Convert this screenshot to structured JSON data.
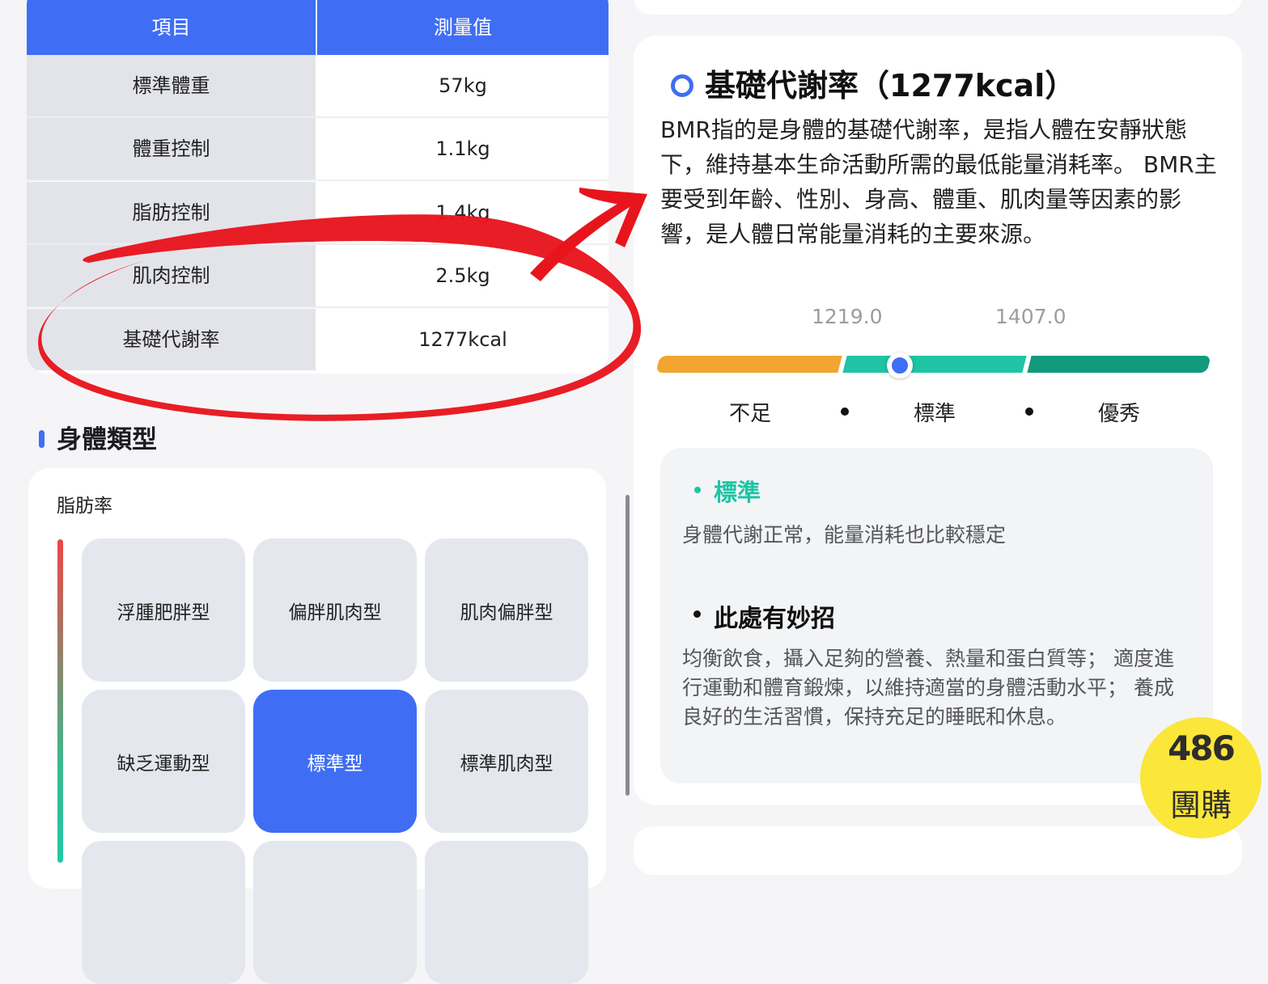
{
  "table": {
    "header": {
      "item": "項目",
      "value": "測量值"
    },
    "rows": [
      {
        "label": "標準體重",
        "value": "57kg"
      },
      {
        "label": "體重控制",
        "value": "1.1kg"
      },
      {
        "label": "脂肪控制",
        "value": "1.4kg"
      },
      {
        "label": "肌肉控制",
        "value": "2.5kg"
      },
      {
        "label": "基礎代謝率",
        "value": "1277kcal"
      }
    ]
  },
  "body_type": {
    "title": "身體類型",
    "axis_label": "脂肪率",
    "tiles": [
      {
        "label": "浮腫肥胖型",
        "active": false
      },
      {
        "label": "偏胖肌肉型",
        "active": false
      },
      {
        "label": "肌肉偏胖型",
        "active": false
      },
      {
        "label": "缺乏運動型",
        "active": false
      },
      {
        "label": "標準型",
        "active": true
      },
      {
        "label": "標準肌肉型",
        "active": false
      }
    ]
  },
  "bmr": {
    "title": "基礎代謝率（1277kcal）",
    "description": "BMR指的是身體的基礎代謝率，是指人體在安靜狀態下，維持基本生命活動所需的最低能量消耗率。 BMR主要受到年齡、性別、身高、體重、肌肉量等因素的影響，是人體日常能量消耗的主要來源。",
    "thresholds": [
      "1219.0",
      "1407.0"
    ],
    "ranges": [
      "不足",
      "標準",
      "優秀"
    ],
    "range_colors": [
      "#f2a530",
      "#1ec4a4",
      "#129a7d"
    ],
    "status": {
      "label": "標準",
      "color": "#1ec4a4",
      "description": "身體代謝正常，能量消耗也比較穩定"
    },
    "tip": {
      "title": "此處有妙招",
      "text": "均衡飲食，攝入足夠的營養、熱量和蛋白質等； 適度進行運動和體育鍛煉，以維持適當的身體活動水平； 養成良好的生活習慣，保持充足的睡眠和休息。"
    }
  },
  "watermark": {
    "number": "486",
    "text": "團購"
  },
  "colors": {
    "accent": "#3f6ef4",
    "highlight": "#e8141c"
  }
}
